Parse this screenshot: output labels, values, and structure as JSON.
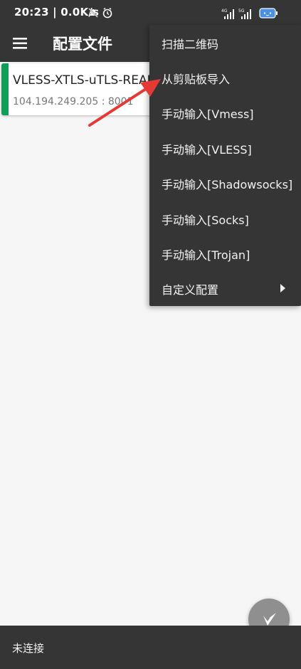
{
  "status_bar": {
    "time_speed": "20:23 | 0.0K/s",
    "network_4g": "4G",
    "network_5g": "5G"
  },
  "app_bar": {
    "title": "配置文件"
  },
  "server_card": {
    "name": "VLESS-XTLS-uTLS-REALITY",
    "address": "104.194.249.205 : 8001",
    "accent_color": "#109d58"
  },
  "dropdown_menu": {
    "items": [
      "扫描二维码",
      "从剪贴板导入",
      "手动输入[Vmess]",
      "手动输入[VLESS]",
      "手动输入[Shadowsocks]",
      "手动输入[Socks]",
      "手动输入[Trojan]",
      "自定义配置"
    ]
  },
  "bottom_bar": {
    "status": "未连接"
  },
  "colors": {
    "toolbar": "#353535",
    "background": "#f6f6f6",
    "annotation_arrow": "#e53935",
    "fab": "#8f8f8f"
  }
}
